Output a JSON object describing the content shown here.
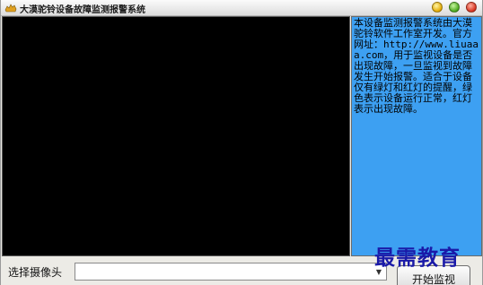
{
  "window": {
    "title": "大漠驼铃设备故障监测报警系统"
  },
  "info_panel": {
    "text": "本设备监测报警系统由大漠驼铃软件工作室开发。官方网址：http://www.liuaaa.com，用于监视设备是否出现故障，一旦监视到故障发生开始报警。适合于设备仅有绿灯和红灯的提醒，绿色表示设备运行正常，红灯表示出现故障。"
  },
  "controls": {
    "camera_label": "选择摄像头",
    "camera_value": "",
    "start_button_label": "开始监视"
  },
  "watermark": {
    "text": "最需教育"
  },
  "colors": {
    "info_background": "#3da0f2",
    "video_background": "#000000",
    "watermark": "#1a1aa8"
  },
  "icons": {
    "app": "camel-icon",
    "minimize": "minimize-dot-icon",
    "maximize": "maximize-dot-icon",
    "close": "close-dot-icon",
    "dropdown": "chevron-down-icon"
  }
}
